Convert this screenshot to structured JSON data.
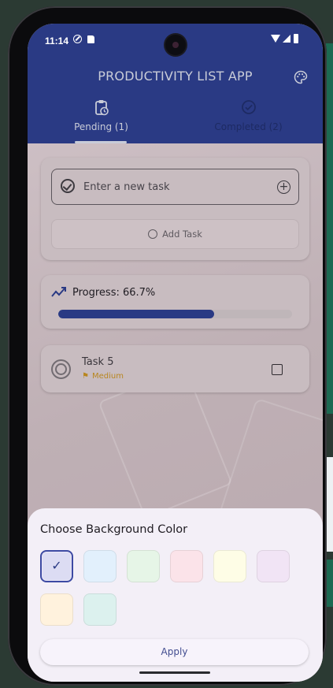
{
  "status_bar": {
    "time": "11:14"
  },
  "app": {
    "title": "PRODUCTIVITY LIST APP"
  },
  "tabs": [
    {
      "label": "Pending (1)",
      "active": true
    },
    {
      "label": "Completed (2)",
      "active": false
    }
  ],
  "task_input": {
    "placeholder": "Enter a new task",
    "value": ""
  },
  "add_task_button": {
    "label": "Add Task"
  },
  "progress": {
    "label": "Progress: 66.7%",
    "value": 0.667
  },
  "tasks": [
    {
      "title": "Task 5",
      "priority": "Medium",
      "done": false
    }
  ],
  "bottom_sheet": {
    "title": "Choose Background Color",
    "colors": [
      "#dcdcf3",
      "#e2f0fc",
      "#e6f5e7",
      "#fbe3e9",
      "#fefde6",
      "#f1e4f5",
      "#fff2dd",
      "#dcf1ee"
    ],
    "selected_index": 0,
    "apply_label": "Apply"
  },
  "icons": {
    "palette": "palette-icon",
    "pending_tab": "clipboard-clock-icon",
    "completed_tab": "check-circle-icon",
    "progress": "trending-up-icon",
    "priority": "flag-icon"
  },
  "colors": {
    "primary": "#2a3a84",
    "priority_medium": "#b8861f"
  }
}
